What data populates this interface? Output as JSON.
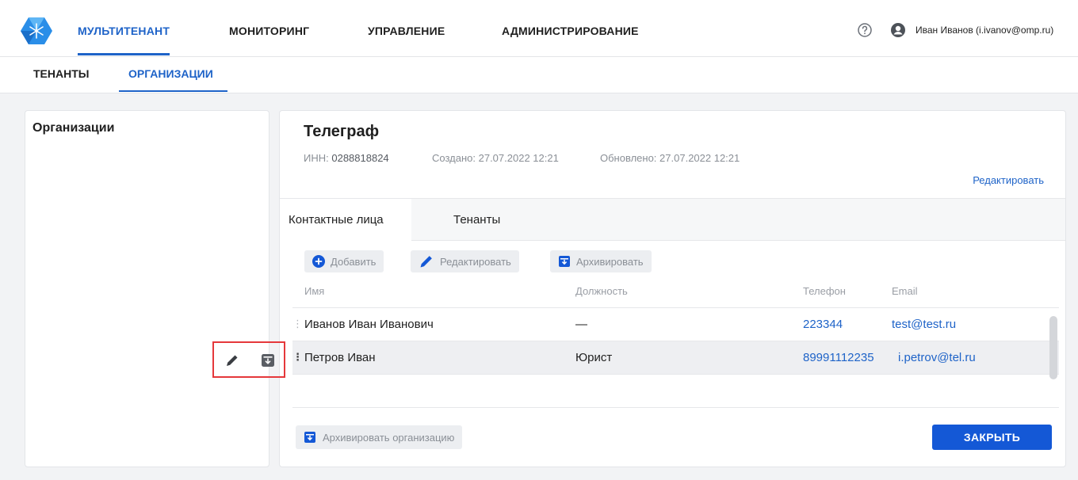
{
  "header": {
    "nav": [
      "МУЛЬТИТЕНАНТ",
      "МОНИТОРИНГ",
      "УПРАВЛЕНИЕ",
      "АДМИНИСТРИРОВАНИЕ"
    ],
    "user": "Иван Иванов (i.ivanov@omp.ru)"
  },
  "subnav": [
    "ТЕНАНТЫ",
    "ОРГАНИЗАЦИИ"
  ],
  "left_panel": {
    "title": "Организации"
  },
  "org": {
    "name": "Телеграф",
    "inn_label": "ИНН:",
    "inn": "0288818824",
    "created_label": "Создано:",
    "created": "27.07.2022 12:21",
    "updated_label": "Обновлено:",
    "updated": "27.07.2022 12:21",
    "edit_link": "Редактировать"
  },
  "tabs": [
    "Контактные лица",
    "Тенанты"
  ],
  "toolbar": {
    "add": "Добавить",
    "edit": "Редактировать",
    "archive": "Архивировать"
  },
  "table": {
    "columns": [
      "Имя",
      "Должность",
      "Телефон",
      "Email"
    ],
    "rows": [
      {
        "name": "Иванов Иван Иванович",
        "position": "—",
        "phone": "223344",
        "email": "test@test.ru"
      },
      {
        "name": "Петров Иван",
        "position": "Юрист",
        "phone": "89991112235",
        "email": "i.petrov@tel.ru"
      }
    ]
  },
  "footer": {
    "archive_org": "Архивировать организацию",
    "close": "ЗАКРЫТЬ"
  },
  "colors": {
    "accent": "#1e63c8",
    "primary_button": "#1458d6",
    "highlight_frame": "#e5383b"
  }
}
